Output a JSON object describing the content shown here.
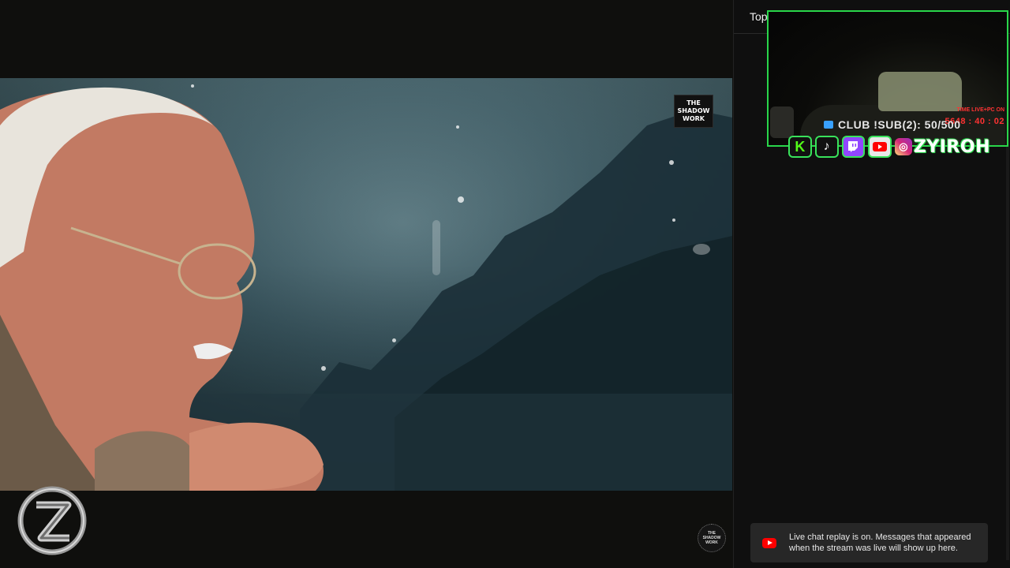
{
  "chat": {
    "header_label": "Top",
    "replay_notice": "Live chat replay is on. Messages that appeared when the stream was live will show up here."
  },
  "video": {
    "watermark_line1": "THE",
    "watermark_line2": "SHADOW",
    "watermark_line3": "WORK",
    "bottom_logo_line1": "THE",
    "bottom_logo_line2": "SHADOW",
    "bottom_logo_line3": "WORK"
  },
  "overlay": {
    "live_label": "TIME LIVE+PC ON",
    "live_timer": "5648 : 40 : 02",
    "club_text": "CLUB !SUB(2): 50/500",
    "handle": "ZYIROH",
    "social_icons": [
      "kick-icon",
      "tiktok-icon",
      "twitch-icon",
      "youtube-icon",
      "instagram-icon"
    ]
  },
  "colors": {
    "accent_green": "#29d64a",
    "live_red": "#ff3232",
    "youtube_red": "#ff0000",
    "twitch_purple": "#9146ff"
  }
}
